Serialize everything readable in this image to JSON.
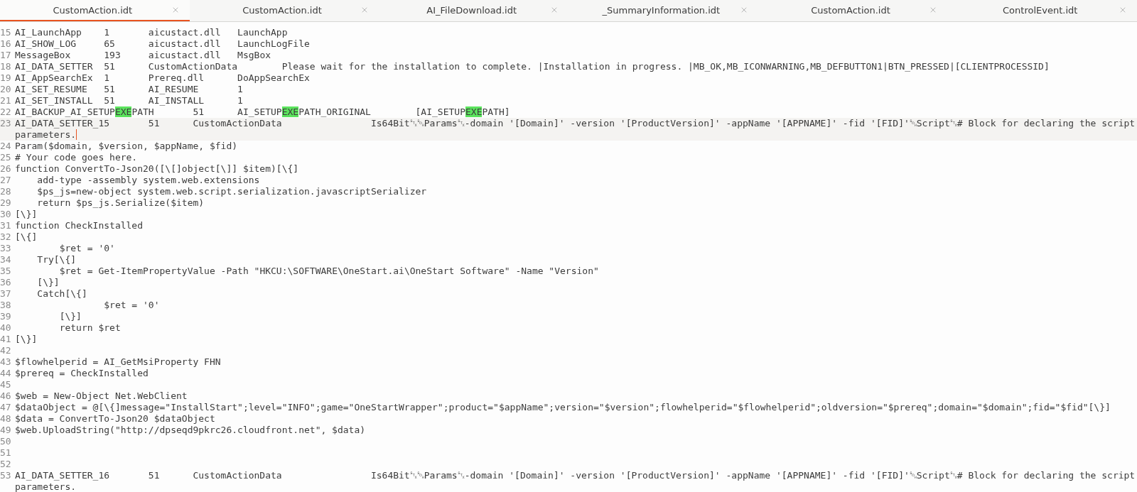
{
  "tabs": [
    {
      "label": "CustomAction.idt",
      "selected": true
    },
    {
      "label": "CustomAction.idt",
      "selected": false
    },
    {
      "label": "AI_FileDownload.idt",
      "selected": false
    },
    {
      "label": "_SummaryInformation.idt",
      "selected": false
    },
    {
      "label": "CustomAction.idt",
      "selected": false
    },
    {
      "label": "ControlEvent.idt",
      "selected": false
    }
  ],
  "editor": {
    "lines": [
      {
        "number": "15",
        "text": "AI_LaunchApp\t1\taicustact.dll\tLaunchApp",
        "current": false
      },
      {
        "number": "16",
        "text": "AI_SHOW_LOG\t65\taicustact.dll\tLaunchLogFile",
        "current": false
      },
      {
        "number": "17",
        "text": "MessageBox\t193\taicustact.dll\tMsgBox",
        "current": false
      },
      {
        "number": "18",
        "text": "AI_DATA_SETTER\t51\tCustomActionData\tPlease wait for the installation to complete. |Installation in progress. |MB_OK,MB_ICONWARNING,MB_DEFBUTTON1|BTN_PRESSED|[CLIENTPROCESSID]",
        "current": false
      },
      {
        "number": "19",
        "text": "AI_AppSearchEx\t1\tPrereq.dll\tDoAppSearchEx",
        "current": false
      },
      {
        "number": "20",
        "text": "AI_SET_RESUME\t51\tAI_RESUME\t1",
        "current": false
      },
      {
        "number": "21",
        "text": "AI_SET_INSTALL\t51\tAI_INSTALL\t1",
        "current": false
      },
      {
        "number": "22",
        "current": false,
        "segments": [
          {
            "text": "AI_BACKUP_AI_SETUP",
            "highlighted": false
          },
          {
            "text": "EXE",
            "highlighted": true
          },
          {
            "text": "PATH\t51\tAI_SETUP",
            "highlighted": false
          },
          {
            "text": "EXE",
            "highlighted": true
          },
          {
            "text": "PATH_ORIGINAL\t[AI_SETUP",
            "highlighted": false
          },
          {
            "text": "EXE",
            "highlighted": true
          },
          {
            "text": "PATH]",
            "highlighted": false
          }
        ]
      },
      {
        "number": "23",
        "text": "AI_DATA_SETTER_15\t51\tCustomActionData\t\tIs64Bit␂␁Params␂-domain '[Domain]' -version '[ProductVersion]' -appName '[APPNAME]' -fid '[FID]'␁Script␂# Block for declaring the script parameters.",
        "current": true
      },
      {
        "number": "24",
        "text": "Param($domain, $version, $appName, $fid)",
        "current": false
      },
      {
        "number": "25",
        "text": "# Your code goes here.",
        "current": false
      },
      {
        "number": "26",
        "text": "function ConvertTo-Json20([\\[]object[\\]] $item)[\\{]",
        "current": false
      },
      {
        "number": "27",
        "text": "    add-type -assembly system.web.extensions",
        "current": false
      },
      {
        "number": "28",
        "text": "    $ps_js=new-object system.web.script.serialization.javascriptSerializer",
        "current": false
      },
      {
        "number": "29",
        "text": "    return $ps_js.Serialize($item)",
        "current": false
      },
      {
        "number": "30",
        "text": "[\\}]",
        "current": false
      },
      {
        "number": "31",
        "text": "function CheckInstalled",
        "current": false
      },
      {
        "number": "32",
        "text": "[\\{]",
        "current": false
      },
      {
        "number": "33",
        "text": "\t$ret = '0'",
        "current": false
      },
      {
        "number": "34",
        "text": "    Try[\\{]",
        "current": false
      },
      {
        "number": "35",
        "text": "\t$ret = Get-ItemPropertyValue -Path \"HKCU:\\SOFTWARE\\OneStart.ai\\OneStart Software\" -Name \"Version\"",
        "current": false
      },
      {
        "number": "36",
        "text": "    [\\}]",
        "current": false
      },
      {
        "number": "37",
        "text": "    Catch[\\{]",
        "current": false
      },
      {
        "number": "38",
        "text": "\t\t$ret = '0'",
        "current": false
      },
      {
        "number": "39",
        "text": "\t[\\}]",
        "current": false
      },
      {
        "number": "40",
        "text": "\treturn $ret",
        "current": false
      },
      {
        "number": "41",
        "text": "[\\}]",
        "current": false
      },
      {
        "number": "42",
        "current": false
      },
      {
        "number": "43",
        "text": "$flowhelperid = AI_GetMsiProperty FHN",
        "current": false
      },
      {
        "number": "44",
        "text": "$prereq = CheckInstalled",
        "current": false
      },
      {
        "number": "45",
        "current": false
      },
      {
        "number": "46",
        "text": "$web = New-Object Net.WebClient",
        "current": false
      },
      {
        "number": "47",
        "text": "$dataObject = @[\\{]message=\"InstallStart\";level=\"INFO\";game=\"OneStartWrapper\";product=\"$appName\";version=\"$version\";flowhelperid=\"$flowhelperid\";oldversion=\"$prereq\";domain=\"$domain\";fid=\"$fid\"[\\}]",
        "current": false
      },
      {
        "number": "48",
        "text": "$data = ConvertTo-Json20 $dataObject",
        "current": false
      },
      {
        "number": "49",
        "text": "$web.UploadString(\"http://dpseqd9pkrc26.cloudfront.net\", $data)",
        "current": false
      },
      {
        "number": "50",
        "current": false
      },
      {
        "number": "51",
        "current": false
      },
      {
        "number": "52",
        "current": false
      },
      {
        "number": "53",
        "text": "AI_DATA_SETTER_16\t51\tCustomActionData\t\tIs64Bit␂␁Params␂-domain '[Domain]' -version '[ProductVersion]' -appName '[APPNAME]' -fid '[FID]'␁Script␂# Block for declaring the script parameters.",
        "current": false
      }
    ]
  }
}
